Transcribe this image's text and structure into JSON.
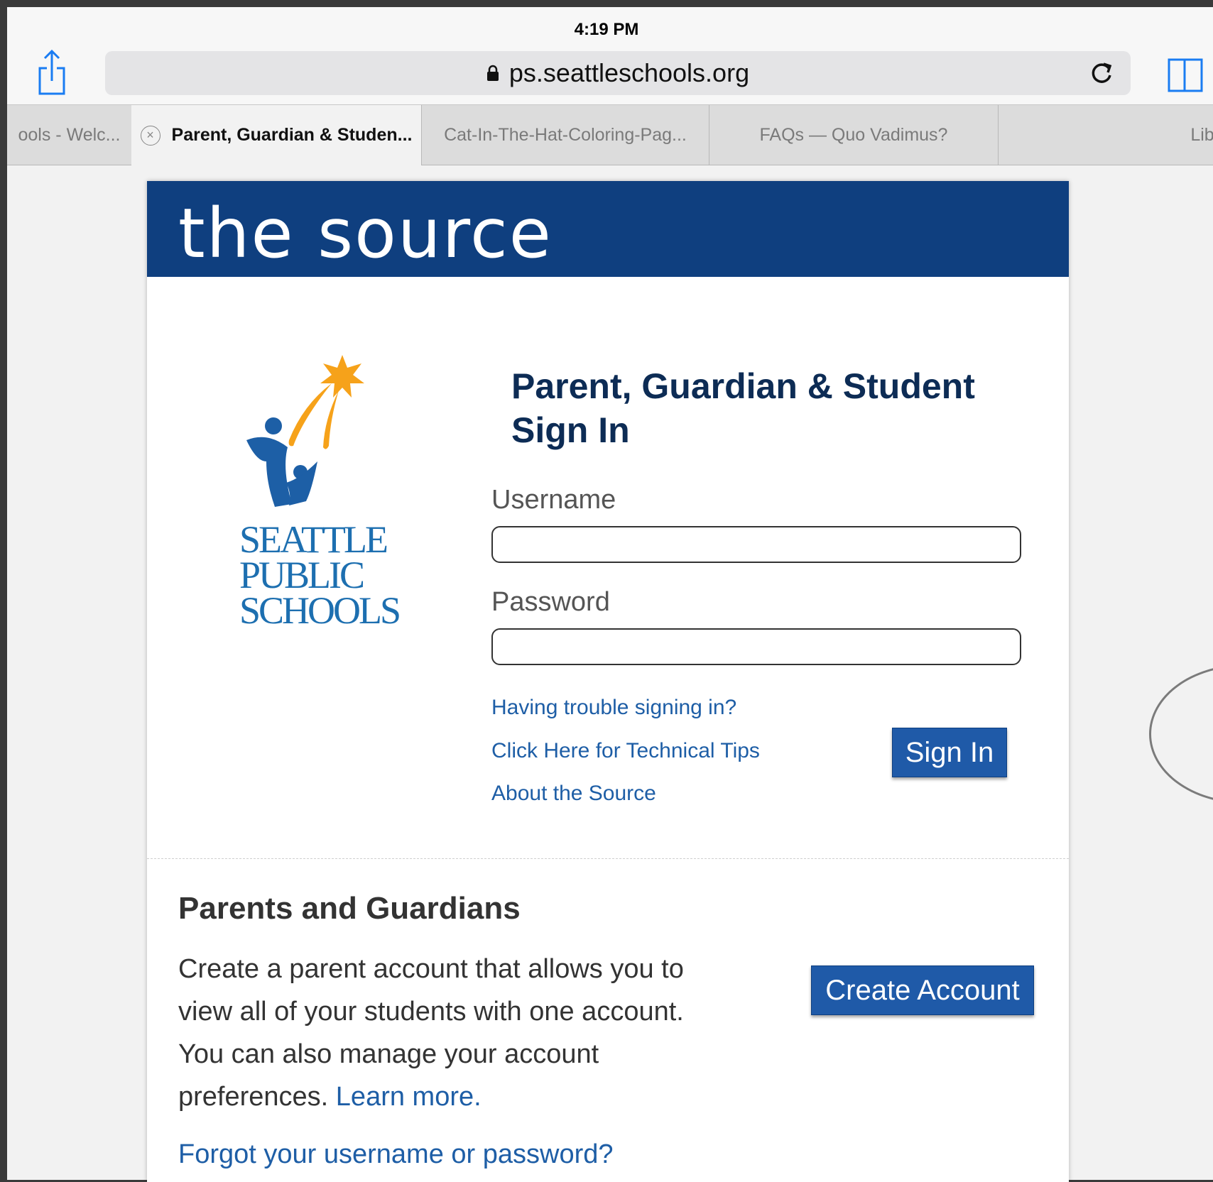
{
  "status_bar": {
    "time": "4:19 PM"
  },
  "browser": {
    "url": "ps.seattleschools.org",
    "tabs": [
      {
        "label": "ools - Welc..."
      },
      {
        "label": "Parent, Guardian & Studen...",
        "active": true
      },
      {
        "label": "Cat-In-The-Hat-Coloring-Pag..."
      },
      {
        "label": "FAQs — Quo Vadimus?"
      },
      {
        "label": "Libr"
      }
    ],
    "icons": {
      "share": "share-icon",
      "lock": "lock-icon",
      "reload": "reload-icon",
      "bookmarks": "book-icon",
      "tab_close": "close-icon"
    }
  },
  "page": {
    "brand": "the source",
    "logo_lines": [
      "SEATTLE",
      "PUBLIC",
      "SCHOOLS"
    ],
    "signin_title_line1": "Parent, Guardian & Student",
    "signin_title_line2": "Sign In",
    "username_label": "Username",
    "username_value": "",
    "password_label": "Password",
    "password_value": "",
    "links": {
      "trouble": "Having trouble signing in?",
      "tips": "Click Here for Technical Tips",
      "about": "About the Source"
    },
    "signin_button": "Sign In",
    "parents_title": "Parents and Guardians",
    "parents_body": "Create a parent account that allows you to view all of your students with one account. You can also manage your account preferences.",
    "learn_more": "Learn more.",
    "create_account_button": "Create Account",
    "forgot_link": "Forgot your username or password?"
  },
  "colors": {
    "header_blue": "#0f3f7f",
    "link_blue": "#1e5ea6",
    "button_blue": "#1f5aa8",
    "logo_orange": "#f6a21a"
  }
}
